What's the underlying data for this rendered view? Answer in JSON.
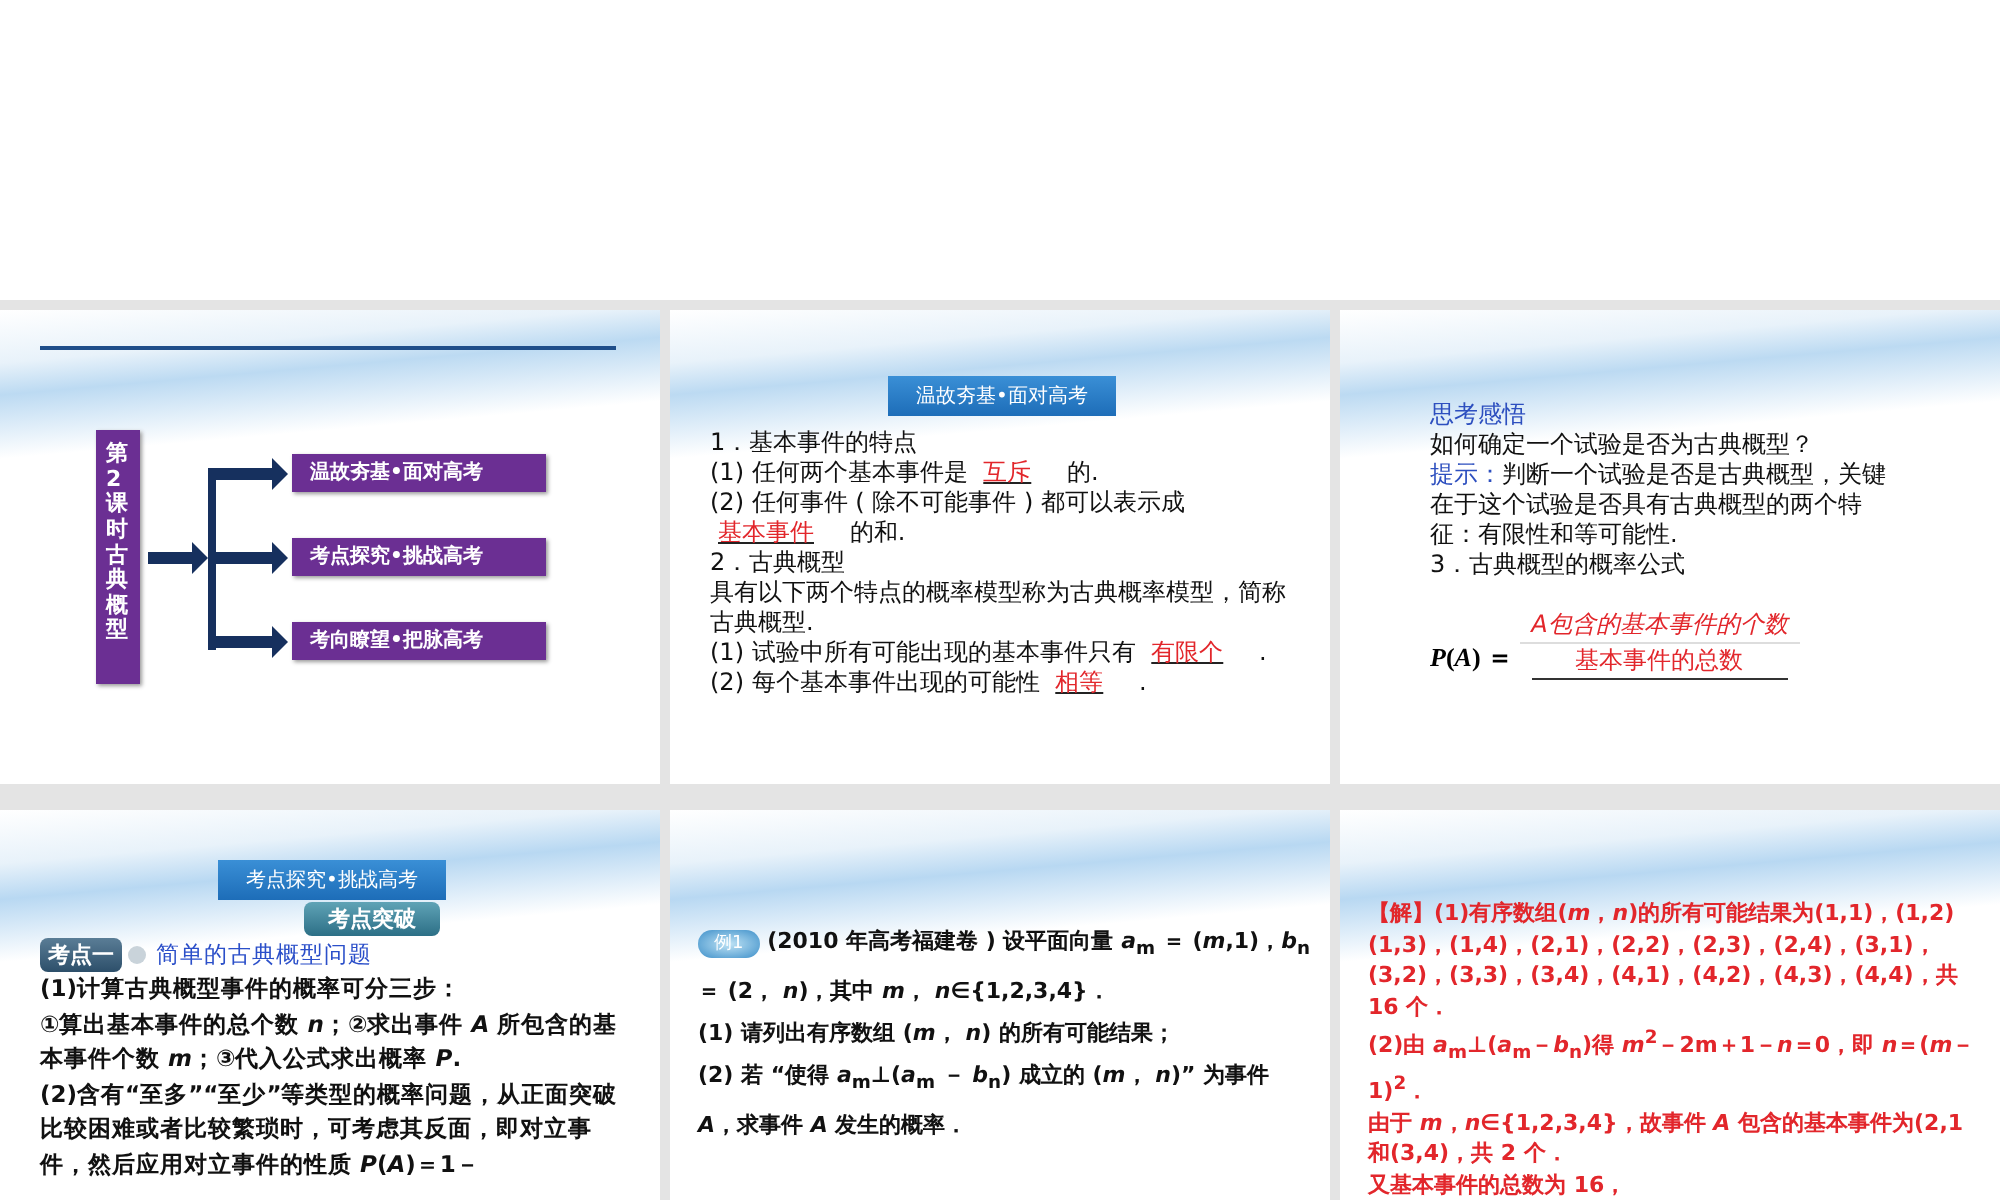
{
  "slides": [
    {
      "kind": "outline",
      "title": "第2课时古典概型",
      "branches": [
        "温故夯基•面对高考",
        "考点探究•挑战高考",
        "考向瞭望•把脉高考"
      ]
    },
    {
      "kind": "content",
      "blocks": [
        {
          "kind": "header",
          "text": "温故夯基•面对高考"
        },
        {
          "kind": "para",
          "segments": [
            {
              "kind": "text",
              "text": "1．基本事件的特点"
            }
          ]
        },
        {
          "kind": "para",
          "segments": [
            {
              "kind": "text",
              "text": "(1) 任何两个基本事件是 "
            },
            {
              "kind": "blank",
              "text": "互斥"
            },
            {
              "kind": "text",
              "text": " 的."
            }
          ]
        },
        {
          "kind": "para",
          "segments": [
            {
              "kind": "text",
              "text": "(2) 任何事件 ( 除不可能事件 ) 都可以表示成"
            }
          ]
        },
        {
          "kind": "para",
          "segments": [
            {
              "kind": "blank",
              "text": "基本事件"
            },
            {
              "kind": "text",
              "text": " 的和."
            }
          ]
        },
        {
          "kind": "para",
          "segments": [
            {
              "kind": "text",
              "text": "2．古典概型"
            }
          ]
        },
        {
          "kind": "para",
          "segments": [
            {
              "kind": "text",
              "text": "具有以下两个特点的概率模型称为古典概率模型，简称古典概型."
            }
          ]
        },
        {
          "kind": "para",
          "segments": [
            {
              "kind": "text",
              "text": "(1) 试验中所有可能出现的基本事件只有 "
            },
            {
              "kind": "blank",
              "text": "有限个"
            },
            {
              "kind": "text",
              "text": " ."
            }
          ]
        },
        {
          "kind": "para",
          "segments": [
            {
              "kind": "text",
              "text": "(2) 每个基本事件出现的可能性 "
            },
            {
              "kind": "blank",
              "text": "相等"
            },
            {
              "kind": "text",
              "text": " ."
            }
          ]
        }
      ]
    },
    {
      "kind": "content",
      "blocks": [
        {
          "kind": "para",
          "segments": [
            {
              "kind": "label",
              "text": "思考感悟"
            }
          ]
        },
        {
          "kind": "para",
          "segments": [
            {
              "kind": "text",
              "text": "如何确定一个试验是否为古典概型？"
            }
          ]
        },
        {
          "kind": "para",
          "segments": [
            {
              "kind": "label",
              "text": "提示："
            },
            {
              "kind": "text",
              "text": "判断一个试验是否是古典概型，关键在于这个试验是否具有古典概型的两个特征：有限性和等可能性."
            }
          ]
        },
        {
          "kind": "para",
          "segments": [
            {
              "kind": "text",
              "text": "3．古典概型的概率公式"
            }
          ]
        },
        {
          "kind": "formula",
          "lhs": "*P*(*A*) ＝",
          "numerator": "A包含的基本事件的个数",
          "denominator": "基本事件的总数"
        }
      ]
    },
    {
      "kind": "content",
      "blocks": [
        {
          "kind": "header",
          "text": "考点探究•挑战高考"
        },
        {
          "kind": "subheader",
          "text": "考点突破"
        },
        {
          "kind": "topic",
          "badge": "考点一",
          "title": "简单的古典概型问题"
        },
        {
          "kind": "para",
          "segments": [
            {
              "kind": "text",
              "text": "(1)计算古典概型事件的概率可分三步："
            }
          ]
        },
        {
          "kind": "para",
          "segments": [
            {
              "kind": "text",
              "text": "①算出基本事件的总个数 *n*；②求出事件 *A* 所包含的基本事件个数 *m*；③代入公式求出概率 *P*."
            }
          ]
        },
        {
          "kind": "para",
          "segments": [
            {
              "kind": "text",
              "text": "(2)含有“至多”“至少”等类型的概率问题，从正面突破比较困难或者比较繁琐时，可考虑其反面，即对立事件，然后应用对立事件的性质 *P*(*A*)＝1－"
            }
          ]
        }
      ]
    },
    {
      "kind": "content",
      "blocks": [
        {
          "kind": "example",
          "badge": "例1",
          "text": "(2010 年高考福建卷 ) 设平面向量 *a*$_{m}$ ＝ (*m*,1)，*b*$_{n}$ ＝ (2， *n*)，其中 *m*， *n*∈{1,2,3,4}．"
        },
        {
          "kind": "para",
          "segments": [
            {
              "kind": "text",
              "text": "(1) 请列出有序数组 (*m*， *n*) 的所有可能结果；"
            }
          ]
        },
        {
          "kind": "para",
          "segments": [
            {
              "kind": "text",
              "text": "(2) 若 “使得 *a*$_{m}$⊥(*a*$_{m}$ － *b*$_{n}$) 成立的 (*m*， *n*)” 为事件 *A*，求事件 *A* 发生的概率．"
            }
          ]
        }
      ]
    },
    {
      "kind": "content",
      "blocks": [
        {
          "kind": "para",
          "segments": [
            {
              "kind": "answer",
              "text": "【解】(1)有序数组(*m*，*n*)的所有可能结果为(1,1)，(1,2)(1,3)，(1,4)，(2,1)，(2,2)，(2,3)，(2,4)，(3,1)，(3,2)，(3,3)，(3,4)，(4,1)，(4,2)，(4,3)，(4,4)，共 16 个．"
            }
          ]
        },
        {
          "kind": "para",
          "segments": [
            {
              "kind": "answer",
              "text": "(2)由 *a*$_{m}$⊥(*a*$_{m}$－*b*$_{n}$)得 *m*$^{2}$－2m＋1－*n*＝0，即 *n*＝(*m*－1)$^{2}$．"
            }
          ]
        },
        {
          "kind": "para",
          "segments": [
            {
              "kind": "answer",
              "text": "由于 *m*，*n*∈{1,2,3,4}，故事件 *A* 包含的基本事件为(2,1和(3,4)，共 2 个．"
            }
          ]
        },
        {
          "kind": "para",
          "segments": [
            {
              "kind": "answer",
              "text": "又基本事件的总数为 16，"
            }
          ]
        }
      ]
    }
  ]
}
